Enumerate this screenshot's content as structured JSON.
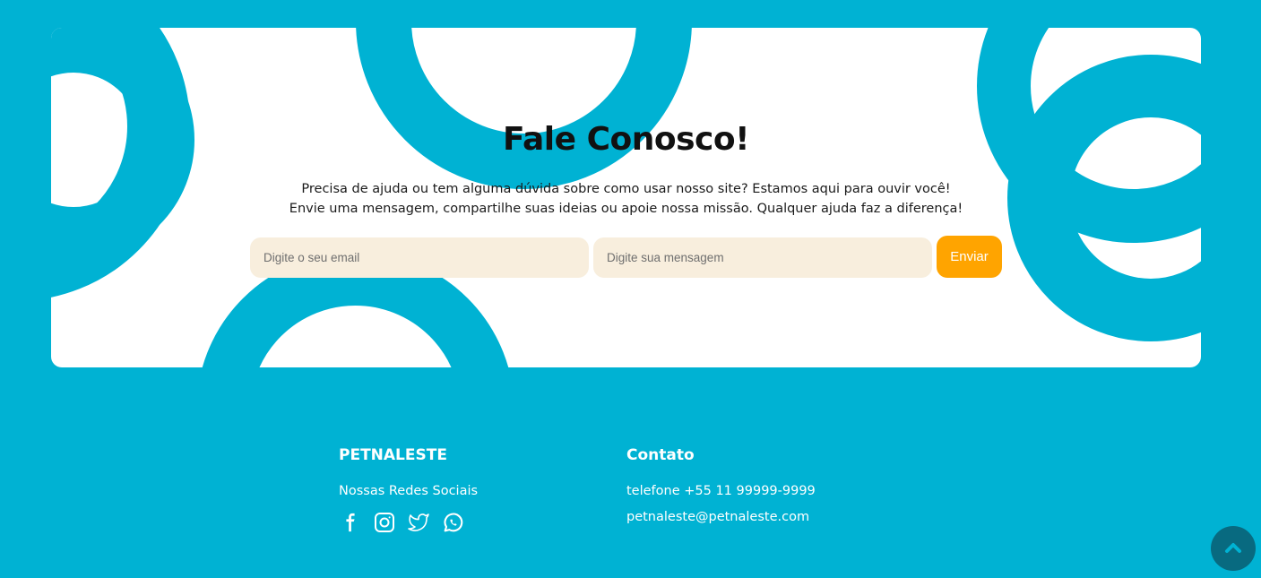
{
  "contact": {
    "title": "Fale Conosco!",
    "subtitle_line1": "Precisa de ajuda ou tem alguma dúvida sobre como usar nosso site? Estamos aqui para ouvir você!",
    "subtitle_line2": "Envie uma mensagem, compartilhe suas ideias ou apoie nossa missão. Qualquer ajuda faz a diferença!",
    "email_placeholder": "Digite o seu email",
    "email_value": "",
    "message_placeholder": "Digite sua mensagem",
    "message_value": "",
    "send_label": "Enviar"
  },
  "footer": {
    "brand": {
      "heading": "PETNALESTE",
      "social_label": "Nossas Redes Sociais",
      "social_icons": [
        "facebook-icon",
        "instagram-icon",
        "twitter-icon",
        "whatsapp-icon"
      ]
    },
    "contact": {
      "heading": "Contato",
      "phone": "telefone +55 11 99999-9999",
      "email": "petnaleste@petnaleste.com"
    }
  },
  "scroll_top_icon": "chevron-up-icon",
  "colors": {
    "background": "#00b2d3",
    "card": "#ffffff",
    "input_bg": "#f8eedd",
    "button": "#ffa400",
    "scroll_button": "#086a80"
  }
}
